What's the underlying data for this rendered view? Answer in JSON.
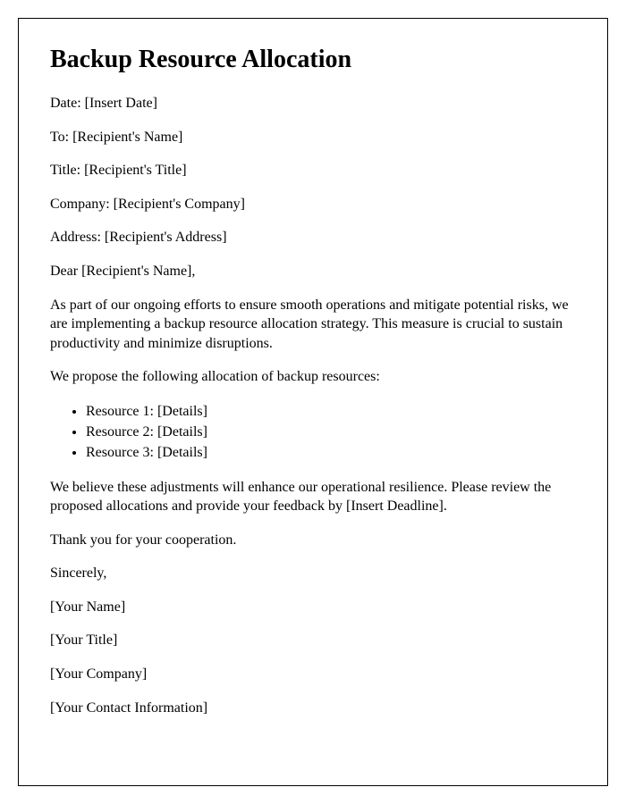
{
  "title": "Backup Resource Allocation",
  "fields": {
    "date": "Date: [Insert Date]",
    "to": "To: [Recipient's Name]",
    "recipient_title": "Title: [Recipient's Title]",
    "company": "Company: [Recipient's Company]",
    "address": "Address: [Recipient's Address]"
  },
  "salutation": "Dear [Recipient's Name],",
  "body": {
    "intro": "As part of our ongoing efforts to ensure smooth operations and mitigate potential risks, we are implementing a backup resource allocation strategy. This measure is crucial to sustain productivity and minimize disruptions.",
    "proposal_lead": "We propose the following allocation of backup resources:",
    "resources": [
      "Resource 1: [Details]",
      "Resource 2: [Details]",
      "Resource 3: [Details]"
    ],
    "closing_para": "We believe these adjustments will enhance our operational resilience. Please review the proposed allocations and provide your feedback by [Insert Deadline].",
    "thanks": "Thank you for your cooperation."
  },
  "signature": {
    "sincerely": "Sincerely,",
    "name": "[Your Name]",
    "title": "[Your Title]",
    "company": "[Your Company]",
    "contact": "[Your Contact Information]"
  }
}
